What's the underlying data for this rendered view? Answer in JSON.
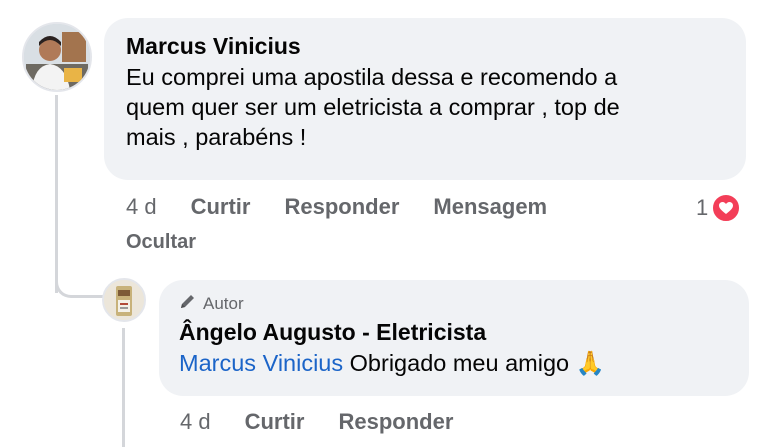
{
  "comment": {
    "author": "Marcus Vinicius",
    "text_lines": [
      "Eu comprei uma apostila dessa e recomendo a",
      "quem quer ser um eletricista a comprar , top de",
      "mais , parabéns !"
    ],
    "time": "4 d",
    "like_label": "Curtir",
    "reply_label": "Responder",
    "message_label": "Mensagem",
    "hide_label": "Ocultar",
    "reaction_count": "1",
    "reaction_icon": "heart-icon",
    "reaction_color": "#f33e58"
  },
  "reply": {
    "badge_label": "Autor",
    "badge_icon": "pencil-icon",
    "author": "Ângelo Augusto - Eletricista",
    "mention": "Marcus Vinicius",
    "text": "Obrigado meu amigo",
    "emoji": "🙏",
    "time": "4 d",
    "like_label": "Curtir",
    "reply_label": "Responder",
    "mention_color": "#1b64c8"
  }
}
